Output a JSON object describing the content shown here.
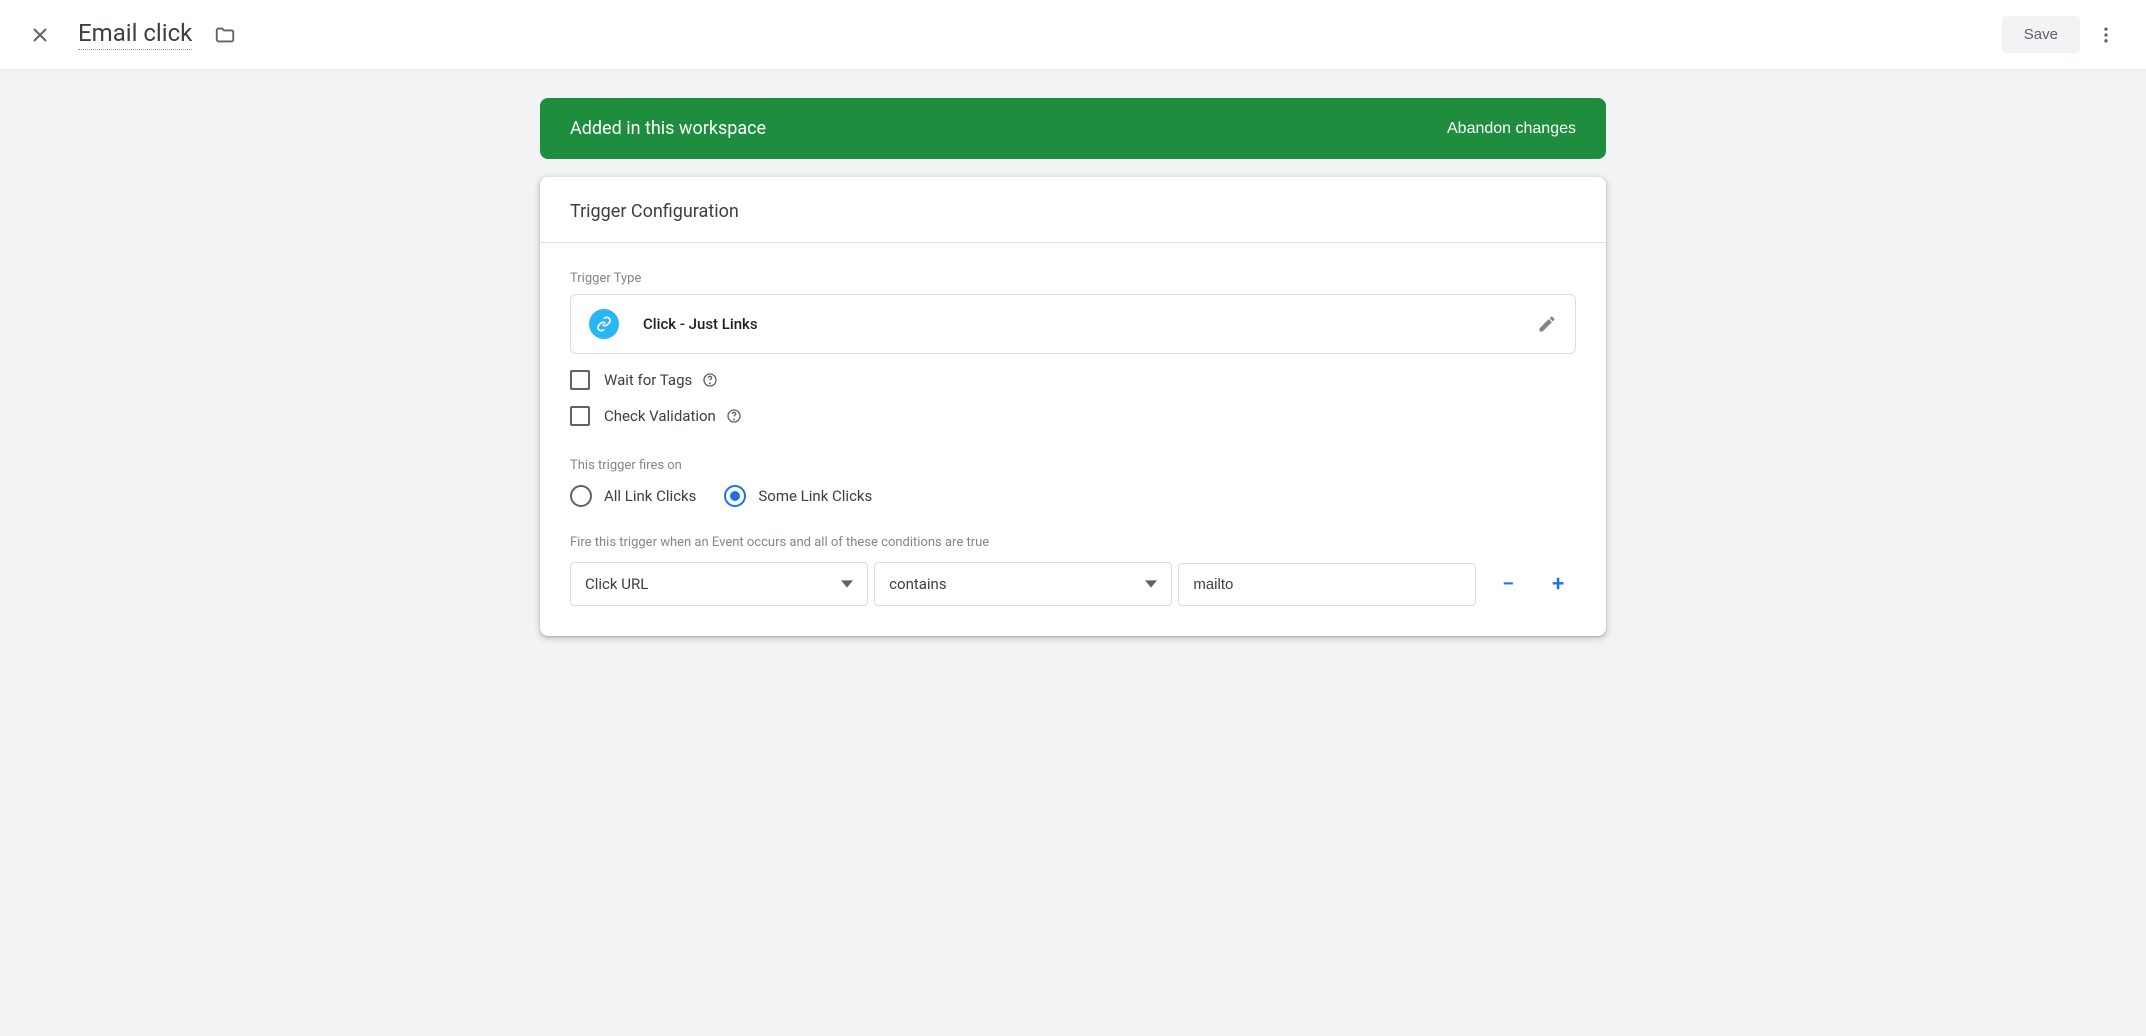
{
  "header": {
    "title": "Email click",
    "save_label": "Save"
  },
  "banner": {
    "text": "Added in this workspace",
    "abandon_label": "Abandon changes"
  },
  "card": {
    "title": "Trigger Configuration",
    "trigger_type_label": "Trigger Type",
    "trigger_type_value": "Click - Just Links",
    "wait_for_tags_label": "Wait for Tags",
    "check_validation_label": "Check Validation",
    "fires_on_label": "This trigger fires on",
    "radio_all_label": "All Link Clicks",
    "radio_some_label": "Some Link Clicks",
    "condition_hint": "Fire this trigger when an Event occurs and all of these conditions are true",
    "condition": {
      "variable": "Click URL",
      "operator": "contains",
      "value": "mailto"
    },
    "remove_label": "−",
    "add_label": "+"
  }
}
